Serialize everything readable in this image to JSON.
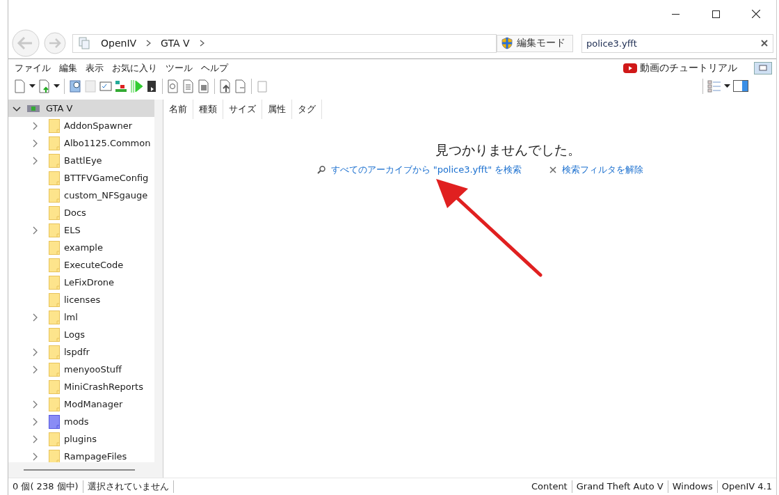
{
  "navigation": {
    "breadcrumb": [
      "OpenIV",
      "GTA V"
    ],
    "edit_mode_button": "編集モード",
    "search": {
      "value": "police3.yfft"
    }
  },
  "menu": [
    "ファイル",
    "編集",
    "表示",
    "お気に入り",
    "ツール",
    "ヘルプ"
  ],
  "tutorial_link": "動画のチュートリアル",
  "tree": {
    "label": "GTA V",
    "expanded": true,
    "selected": true,
    "children": [
      {
        "label": "AddonSpawner",
        "expandable": true,
        "kind": "folder"
      },
      {
        "label": "Albo1125.Common",
        "expandable": true,
        "kind": "folder"
      },
      {
        "label": "BattlEye",
        "expandable": true,
        "kind": "folder"
      },
      {
        "label": "BTTFVGameConfig",
        "expandable": false,
        "kind": "folder"
      },
      {
        "label": "custom_NFSgauge",
        "expandable": false,
        "kind": "folder"
      },
      {
        "label": "Docs",
        "expandable": false,
        "kind": "folder"
      },
      {
        "label": "ELS",
        "expandable": true,
        "kind": "folder"
      },
      {
        "label": "example",
        "expandable": false,
        "kind": "folder"
      },
      {
        "label": "ExecuteCode",
        "expandable": false,
        "kind": "folder"
      },
      {
        "label": "LeFixDrone",
        "expandable": false,
        "kind": "folder"
      },
      {
        "label": "licenses",
        "expandable": false,
        "kind": "folder"
      },
      {
        "label": "lml",
        "expandable": true,
        "kind": "folder"
      },
      {
        "label": "Logs",
        "expandable": false,
        "kind": "folder"
      },
      {
        "label": "lspdfr",
        "expandable": true,
        "kind": "folder"
      },
      {
        "label": "menyooStuff",
        "expandable": true,
        "kind": "folder"
      },
      {
        "label": "MiniCrashReports",
        "expandable": false,
        "kind": "folder"
      },
      {
        "label": "ModManager",
        "expandable": true,
        "kind": "folder"
      },
      {
        "label": "mods",
        "expandable": true,
        "kind": "mods"
      },
      {
        "label": "plugins",
        "expandable": true,
        "kind": "folder"
      },
      {
        "label": "RampageFiles",
        "expandable": true,
        "kind": "folder"
      }
    ]
  },
  "table": {
    "columns": [
      "名前",
      "種類",
      "サイズ",
      "属性",
      "タグ"
    ]
  },
  "empty_message": {
    "title": "見つかりませんでした。",
    "search_all_link": "すべてのアーカイブから \"police3.yfft\" を検索",
    "clear_filter_link": "検索フィルタを解除"
  },
  "status_bar": {
    "count": "0 個( 238 個中)",
    "selection": "選択されていません",
    "items": [
      "Content",
      "Grand Theft Auto V",
      "Windows",
      "OpenIV 4.1"
    ]
  }
}
